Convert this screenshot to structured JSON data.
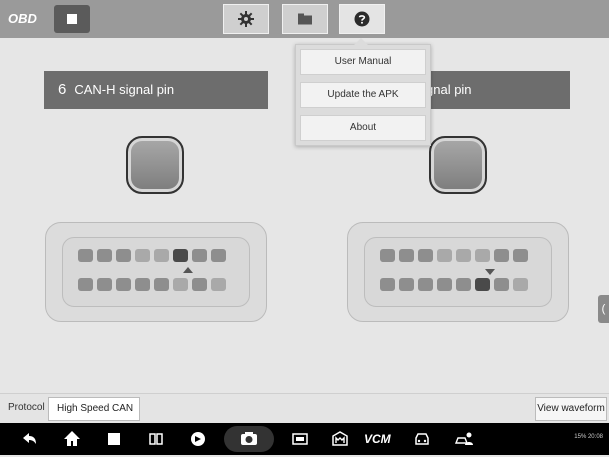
{
  "app": {
    "logo_text": "OBD"
  },
  "toolbar": {
    "stop_icon": "stop-square-icon",
    "settings_icon": "gear-icon",
    "folder_icon": "folder-icon",
    "help_icon": "help-circle-icon"
  },
  "left_panel": {
    "pin_number": "6",
    "pin_label": "CAN-H signal pin"
  },
  "right_panel": {
    "pin_label_partial": "gnal pin"
  },
  "dropdown": {
    "items": [
      {
        "label": "User Manual"
      },
      {
        "label": "Update the APK"
      },
      {
        "label": "About"
      }
    ]
  },
  "bottom": {
    "protocol_label": "Protocol",
    "protocol_value": "High Speed CAN",
    "view_waveform_label": "View waveform"
  },
  "navbar": {
    "vcm_label": "VCM",
    "status_text": "15% 20:08"
  },
  "side_tab": {
    "glyph": "("
  }
}
